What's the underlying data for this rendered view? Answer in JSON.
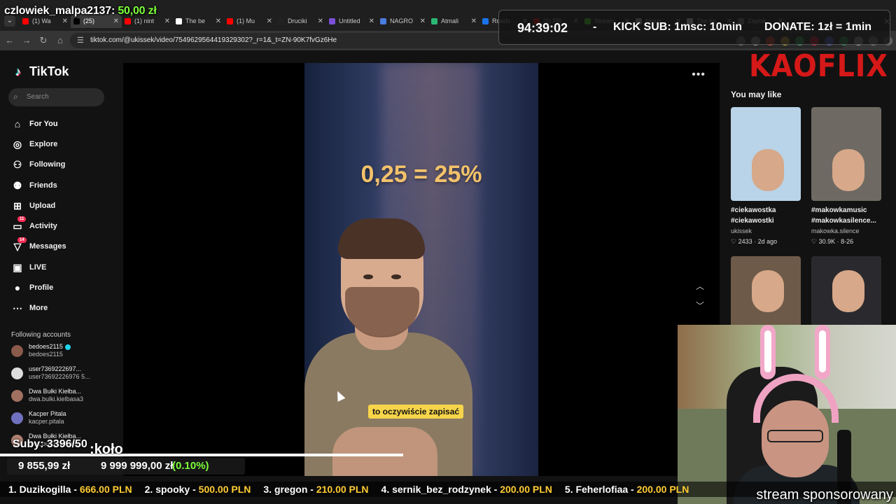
{
  "overlay": {
    "donor_name": "czlowiek_malpa2137:",
    "donor_amount": "50,00 zł",
    "timer": "94:39:02",
    "separator": "-",
    "kick_sub": "KICK SUB: 1msc: 10min",
    "donate": "DONATE: 1zł = 1min",
    "subs": "Suby: 3396/50",
    "kolo": ":koło",
    "money_total": "9 855,99 zł",
    "money_goal": "9 999 999,00 zł",
    "money_pct": "(0.10%)",
    "goal_fraction": 0.45,
    "sponsored": "stream sponsorowany",
    "ticker": [
      {
        "name": "1. Duzikogilla - ",
        "amount": "666.00 PLN"
      },
      {
        "name": "2. spooky - ",
        "amount": "500.00 PLN"
      },
      {
        "name": "3. gregon - ",
        "amount": "210.00 PLN"
      },
      {
        "name": "4. sernik_bez_rodzynek - ",
        "amount": "200.00 PLN"
      },
      {
        "name": "5. Feherlofiaa - ",
        "amount": "200.00 PLN"
      }
    ]
  },
  "browser": {
    "tabs": [
      {
        "label": "(1) Wa",
        "color": "#ff0000"
      },
      {
        "label": "(25)",
        "color": "#000000"
      },
      {
        "label": "(1) nint",
        "color": "#ff0000"
      },
      {
        "label": "The be",
        "color": "#ffffff"
      },
      {
        "label": "(1) Mu",
        "color": "#ff0000"
      },
      {
        "label": "Druciki",
        "color": "#222222"
      },
      {
        "label": "Untitled",
        "color": "#7b4fd6"
      },
      {
        "label": "NAGRO",
        "color": "#4a7be0"
      },
      {
        "label": "Atmali",
        "color": "#2bb673"
      },
      {
        "label": "Roads",
        "color": "#1a73e8"
      },
      {
        "label": "(1) PR",
        "color": "#ff0000"
      },
      {
        "label": "Stream",
        "color": "#53fc18"
      },
      {
        "label": "Nieuc",
        "color": "#cccccc"
      },
      {
        "label": "The be",
        "color": "#ffffff"
      },
      {
        "label": "Zapisk",
        "color": "#888888"
      }
    ],
    "url": "tiktok.com/@ukissek/video/7549629564419329302?_r=1&_t=ZN-90K7fvGz6He"
  },
  "tiktok": {
    "brand": "TikTok",
    "search_placeholder": "Search",
    "nav": [
      {
        "label": "For You",
        "icon": "home-icon",
        "glyph": "⌂"
      },
      {
        "label": "Explore",
        "icon": "compass-icon",
        "glyph": "◎"
      },
      {
        "label": "Following",
        "icon": "following-icon",
        "glyph": "⚇"
      },
      {
        "label": "Friends",
        "icon": "friends-icon",
        "glyph": "⚉"
      },
      {
        "label": "Upload",
        "icon": "upload-icon",
        "glyph": "⊞"
      },
      {
        "label": "Activity",
        "icon": "activity-icon",
        "glyph": "▭",
        "badge": "11"
      },
      {
        "label": "Messages",
        "icon": "messages-icon",
        "glyph": "▽",
        "badge": "14"
      },
      {
        "label": "LIVE",
        "icon": "live-icon",
        "glyph": "▣"
      },
      {
        "label": "Profile",
        "icon": "profile-icon",
        "glyph": "●"
      },
      {
        "label": "More",
        "icon": "more-icon",
        "glyph": "⋯"
      }
    ],
    "following_title": "Following accounts",
    "following": [
      {
        "name": "bedoes2115",
        "handle": "bedoes2115",
        "verified": true,
        "color": "#8a5a4a"
      },
      {
        "name": "user7369222697...",
        "handle": "user73692226976 5...",
        "verified": false,
        "color": "#dddddd"
      },
      {
        "name": "Dwa Bułki Kiełba...",
        "handle": "dwa.bulki.kielbasa3",
        "verified": false,
        "color": "#a07060"
      },
      {
        "name": "Kacper Pitala",
        "handle": "kacper.pitala",
        "verified": false,
        "color": "#7070c0"
      },
      {
        "name": "Dwa Bułki Kiełba...",
        "handle": "dwa.bulki.kielbasa",
        "verified": false,
        "color": "#b08070"
      }
    ],
    "video_caption": "to oczywiście zapisać",
    "formula": "0,25 = 25%",
    "progress_fraction": 0.27,
    "right_brand": "KAOFLIX",
    "you_may_like": "You may like",
    "recommendations": [
      {
        "title": "#ciekawostka #ciekawostki",
        "user": "ukissek",
        "meta": "♡ 2433 · 2d ago",
        "bg": "#b9d3e8"
      },
      {
        "title": "#makowkamusic #makowkasilence...",
        "user": "makowka.silence",
        "meta": "♡ 30.9K · 8-26",
        "bg": "#6e6a63"
      },
      {
        "title": "",
        "user": "",
        "meta": "",
        "bg": "#6d5a48"
      },
      {
        "title": "",
        "user": "",
        "meta": "",
        "bg": "#2a2a2e"
      }
    ]
  }
}
